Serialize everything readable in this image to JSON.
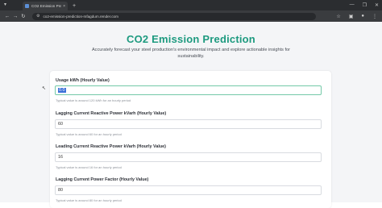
{
  "browser": {
    "tab_title": "CO2 Emission Prediction",
    "tab_close": "×",
    "new_tab": "+",
    "url": "co2-emission-prediction-mfagdum.render.com",
    "win_minimize": "—",
    "win_maximize": "❐",
    "win_close": "✕"
  },
  "page": {
    "title": "CO2 Emission Prediction",
    "subtitle": "Accurately forecast your steel production's environmental impact and explore actionable insights for sustainability."
  },
  "form": {
    "fields": [
      {
        "label": "Usage kWh (Hourly Value)",
        "value": "0.0",
        "hint": "Typical value is around 120 kWh for an hourly period"
      },
      {
        "label": "Lagging Current Reactive Power kVarh (Hourly Value)",
        "value": "60",
        "hint": "Typical value is around 60 for an hourly period"
      },
      {
        "label": "Leading Current Reactive Power kVarh (Hourly Value)",
        "value": "16",
        "hint": "Typical value is around 16 for an hourly period"
      },
      {
        "label": "Lagging Current Power Factor (Hourly Value)",
        "value": "80",
        "hint": "Typical value is around 80 for an hourly period"
      }
    ]
  },
  "colors": {
    "accent": "#1d9a7f",
    "focus_border": "#74c9a8",
    "chrome_dark": "#2b2d30"
  }
}
